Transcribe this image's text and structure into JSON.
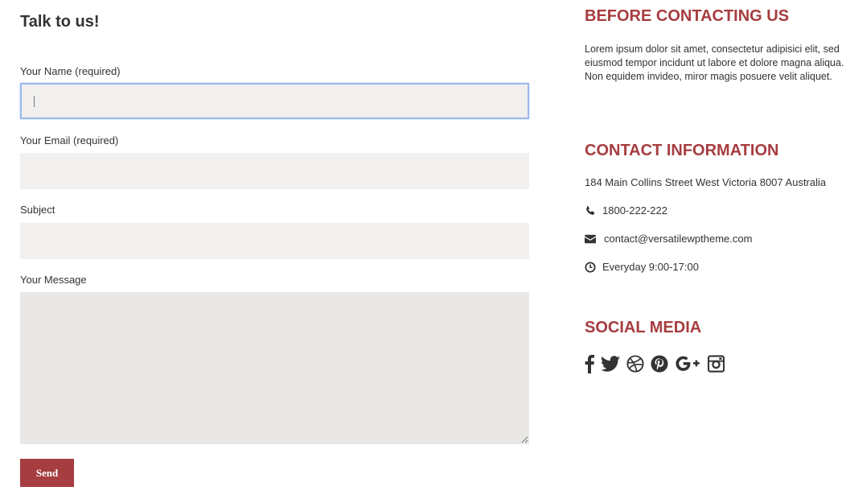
{
  "form": {
    "title": "Talk to us!",
    "name_label": "Your Name (required)",
    "name_value": "",
    "email_label": "Your Email (required)",
    "email_value": "",
    "subject_label": "Subject",
    "subject_value": "",
    "message_label": "Your Message",
    "message_value": "",
    "send_label": "Send"
  },
  "sidebar": {
    "before_heading": "BEFORE CONTACTING US",
    "before_text": "Lorem ipsum dolor sit amet, consectetur adipisici elit, sed eiusmod tempor incidunt ut labore et dolore magna aliqua. Non equidem invideo, miror magis posuere velit aliquet.",
    "contact_heading": "CONTACT INFORMATION",
    "address": "184 Main Collins Street West Victoria 8007 Australia",
    "phone": "1800-222-222",
    "email": "contact@versatilewptheme.com",
    "hours": "Everyday 9:00-17:00",
    "social_heading": "SOCIAL MEDIA",
    "social_icons": [
      "facebook-icon",
      "twitter-icon",
      "dribbble-icon",
      "pinterest-icon",
      "google-plus-icon",
      "instagram-icon"
    ]
  },
  "colors": {
    "accent": "#a63d40",
    "input_bg": "#f1f0ef",
    "focus_border": "#9ab8ef"
  }
}
